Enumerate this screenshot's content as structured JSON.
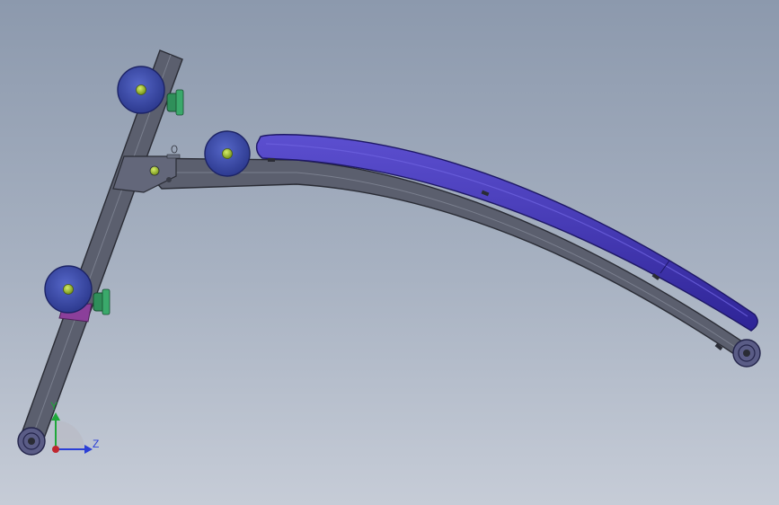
{
  "viewport": {
    "background_top": "#8c99ad",
    "background_bottom": "#c6ccd7"
  },
  "model": {
    "frame_color": "#5b5f6e",
    "frame_edge_color": "#2a2c35",
    "pad_color": "#3a2fa6",
    "pad_highlight": "#5c4fd0",
    "roller_color": "#3c4ba8",
    "roller_hub_color": "#9fbf2e",
    "knob_color": "#2f8f5a",
    "bracket_color": "#8b3f9a",
    "foot_wheel_color": "#5a5c86"
  },
  "triad": {
    "y_label": "Y",
    "z_label": "Z",
    "y_color": "#1fa83a",
    "z_color": "#2b3fd6",
    "origin_color": "#c0262e"
  }
}
